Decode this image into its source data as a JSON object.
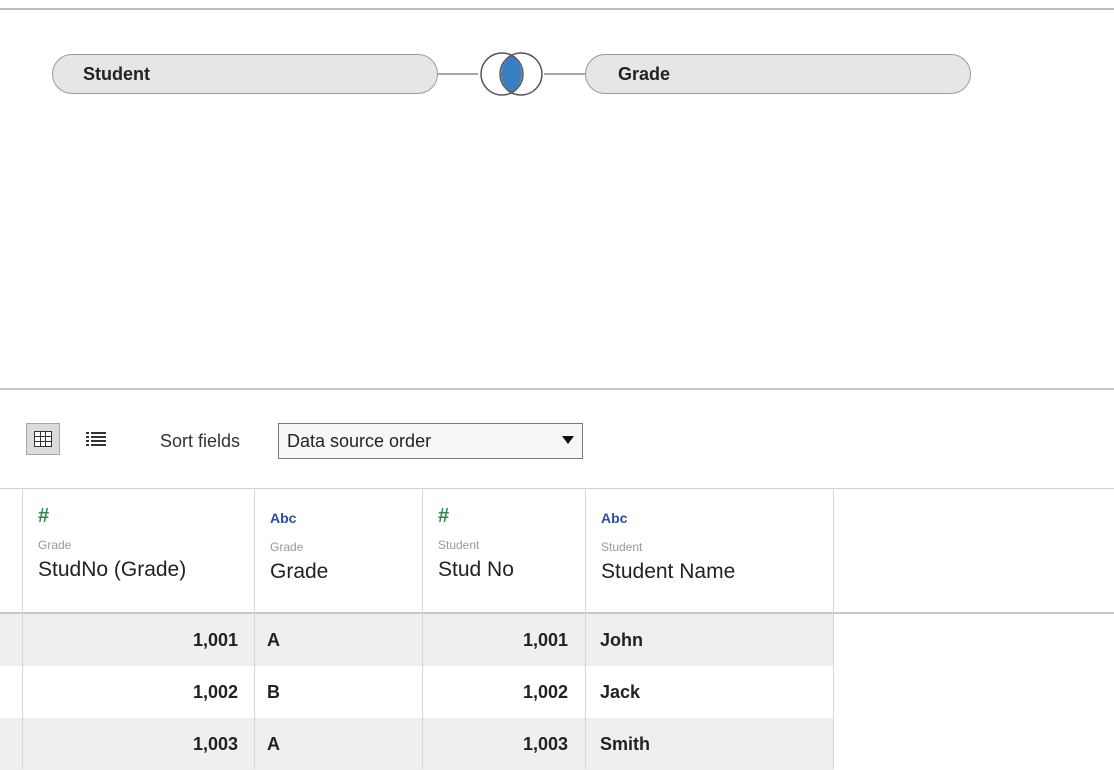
{
  "join": {
    "left_table": "Student",
    "right_table": "Grade",
    "join_type_icon": "inner-join-icon",
    "fill_color": "#3a7fc4"
  },
  "toolbar": {
    "grid_view_icon": "grid-view-icon",
    "list_view_icon": "list-view-icon",
    "sort_label": "Sort fields",
    "sort_value": "Data source order"
  },
  "columns": [
    {
      "type": "#",
      "type_name": "number",
      "source": "Grade",
      "name": "StudNo (Grade)"
    },
    {
      "type": "Abc",
      "type_name": "string",
      "source": "Grade",
      "name": "Grade"
    },
    {
      "type": "#",
      "type_name": "number",
      "source": "Student",
      "name": "Stud No"
    },
    {
      "type": "Abc",
      "type_name": "string",
      "source": "Student",
      "name": "Student Name"
    }
  ],
  "rows": [
    [
      "1,001",
      "A",
      "1,001",
      "John"
    ],
    [
      "1,002",
      "B",
      "1,002",
      "Jack"
    ],
    [
      "1,003",
      "A",
      "1,003",
      "Smith"
    ]
  ]
}
